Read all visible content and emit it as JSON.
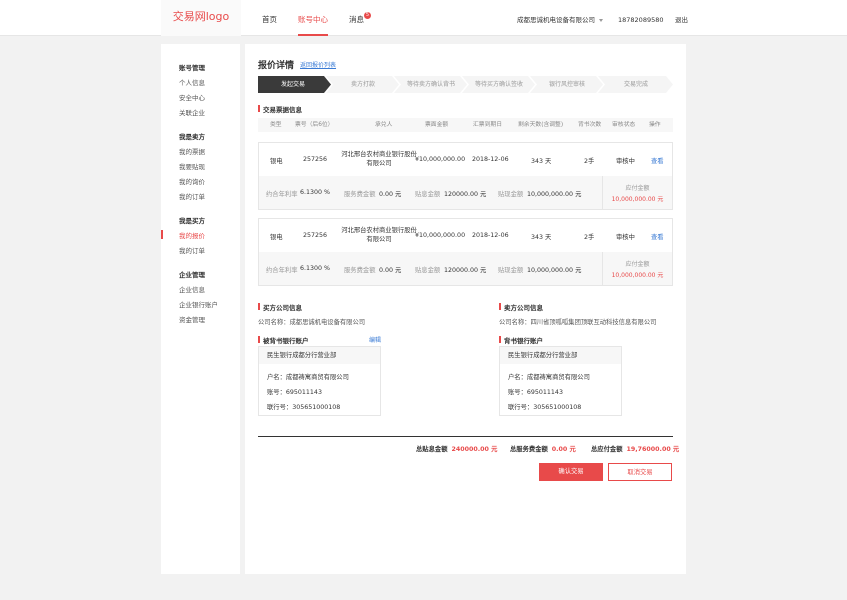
{
  "header": {
    "logo": "交易网logo",
    "nav": [
      "首页",
      "账号中心",
      "消息"
    ],
    "msg_badge": "5",
    "company": "成都思诚机电设备有限公司",
    "phone": "18782089580",
    "logout": "退出"
  },
  "sidebar": {
    "groups": [
      {
        "title": "账号管理",
        "items": [
          "个人信息",
          "安全中心",
          "关联企业"
        ]
      },
      {
        "title": "我是卖方",
        "items": [
          "我的票据",
          "我要贴现",
          "我的询价",
          "我的订单"
        ]
      },
      {
        "title": "我是买方",
        "items": [
          "我的报价",
          "我的订单"
        ]
      },
      {
        "title": "企业管理",
        "items": [
          "企业信息",
          "企业银行账户",
          "资金管理"
        ]
      }
    ],
    "active": "我的报价"
  },
  "main": {
    "title": "报价详情",
    "back_link": "返回报价列表",
    "steps": [
      "发起交易",
      "卖方打款",
      "等待卖方确认背书",
      "等待买方确认签收",
      "银行风控审核",
      "交易完成"
    ],
    "table_section": "交易票据信息",
    "columns": [
      "类型",
      "票号（后6位）",
      "承兑人",
      "票面金额",
      "汇票到期日",
      "剩余天数(含调整)",
      "背书次数",
      "审核状态",
      "操作"
    ],
    "rows": [
      {
        "type": "银电",
        "no": "257256",
        "acceptor": "河北邢台农村商业银行股份有限公司",
        "amount": "¥10,000,000.00",
        "due": "2018-12-06",
        "days": "343 天",
        "endorse": "2手",
        "status": "审核中",
        "action": "查看",
        "rate_label": "约合年利率",
        "rate": "6.1300 %",
        "fee_label": "服务费金额",
        "fee": "0.00 元",
        "disc_label": "贴息金额",
        "disc": "120000.00 元",
        "cash_label": "贴现金额",
        "cash": "10,000,000.00 元",
        "pay_label": "应付金额",
        "pay": "10,000,000.00 元"
      },
      {
        "type": "银电",
        "no": "257256",
        "acceptor": "河北邢台农村商业银行股份有限公司",
        "amount": "¥10,000,000.00",
        "due": "2018-12-06",
        "days": "343 天",
        "endorse": "2手",
        "status": "审核中",
        "action": "查看",
        "rate_label": "约合年利率",
        "rate": "6.1300 %",
        "fee_label": "服务费金额",
        "fee": "0.00 元",
        "disc_label": "贴息金额",
        "disc": "120000.00 元",
        "cash_label": "贴现金额",
        "cash": "10,000,000.00 元",
        "pay_label": "应付金额",
        "pay": "10,000,000.00 元"
      }
    ],
    "buyer": {
      "title": "买方公司信息",
      "company": "公司名称：成都思诚机电设备有限公司",
      "bank_title": "被背书银行账户",
      "edit": "编辑",
      "bank_name": "民生银行成都分行营业部",
      "holder": "户名：成都祷寓商贸有限公司",
      "account": "账号：695011143",
      "routing": "联行号：305651000108"
    },
    "seller": {
      "title": "卖方公司信息",
      "company": "公司名称：四川省顶呱呱集团顶联互动科技信息有限公司",
      "bank_title": "背书银行账户",
      "bank_name": "民生银行成都分行营业部",
      "holder": "户名：成都祷寓商贸有限公司",
      "account": "账号：695011143",
      "routing": "联行号：305651000108"
    },
    "totals": {
      "disc_label": "总贴息金额",
      "disc": "240000.00 元",
      "fee_label": "总服务费金额",
      "fee": "0.00 元",
      "pay_label": "总应付金额",
      "pay": "19,76000.00 元"
    },
    "confirm": "确认交易",
    "cancel": "取消交易"
  },
  "colors": {
    "accent": "#e84a4a",
    "link": "#3a7bd5",
    "step_active": "#3a3a3a"
  }
}
